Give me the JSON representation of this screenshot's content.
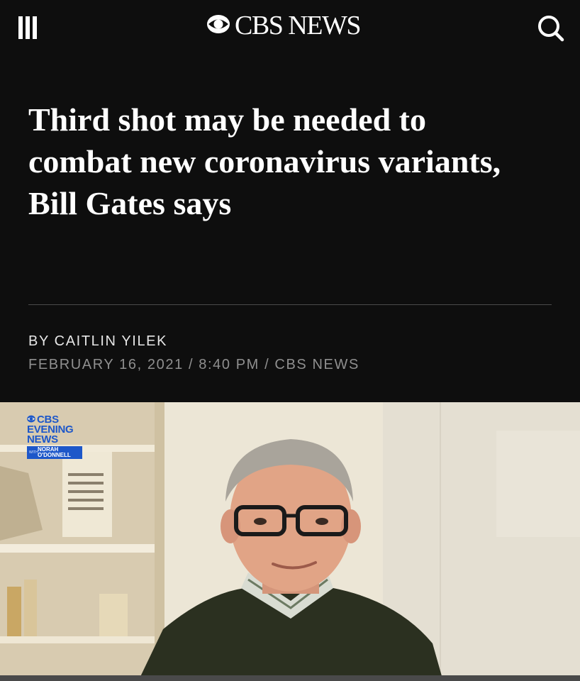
{
  "header": {
    "logo_text": "CBS NEWS",
    "icons": {
      "menu": "hamburger-menu-icon",
      "search": "search-icon",
      "logo_eye": "cbs-eye-icon"
    }
  },
  "article": {
    "headline": "Third shot may be needed to combat new coronavirus variants, Bill Gates says",
    "byline": "BY CAITLIN YILEK",
    "dateline": "FEBRUARY 16, 2021 / 8:40 PM / CBS NEWS"
  },
  "photo": {
    "bug_line1": "CBS",
    "bug_line2": "EVENING",
    "bug_line3": "NEWS",
    "bug_with": "WITH",
    "bug_anchor_line1": "NORAH",
    "bug_anchor_line2": "O'DONNELL"
  },
  "colors": {
    "background": "#0e0e0e",
    "text": "#ffffff",
    "meta_muted": "#8f8f8f",
    "cbs_blue": "#1d57c9"
  }
}
